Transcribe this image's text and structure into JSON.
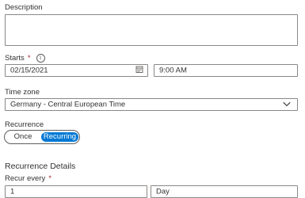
{
  "description": {
    "label": "Description",
    "value": ""
  },
  "starts": {
    "label": "Starts",
    "required_mark": "*",
    "info_icon": "info-icon",
    "date": "02/15/2021",
    "time": "9:00 AM",
    "date_icon": "calendar-icon"
  },
  "timezone": {
    "label": "Time zone",
    "value": "Germany - Central European Time",
    "icon": "chevron-down-icon"
  },
  "recurrence": {
    "label": "Recurrence",
    "options": [
      "Once",
      "Recurring"
    ],
    "selected": "Recurring"
  },
  "recurrence_details": {
    "heading": "Recurrence Details",
    "recur_every": {
      "label": "Recur every",
      "required_mark": "*",
      "value": "1",
      "unit": "Day"
    }
  },
  "colors": {
    "accent": "#0078d4",
    "border": "#8a8886",
    "required": "#a4262c",
    "text": "#323130"
  }
}
